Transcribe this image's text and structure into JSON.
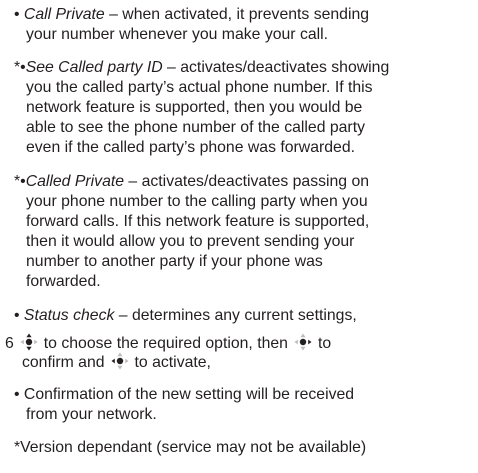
{
  "items": [
    {
      "marker": "•",
      "term": "Call Private",
      "dash": " – ",
      "lines": [
        "when activated, it prevents sending",
        "your number whenever you make your call."
      ]
    },
    {
      "marker": "*•",
      "term": "See Called party ID",
      "dash": " –  ",
      "lines": [
        "activates/deactivates showing",
        "you the called party’s actual phone number. If this",
        "network feature is supported, then you would be",
        "able to see the phone number of the called party",
        "even if the called party’s phone was forwarded."
      ]
    },
    {
      "marker": "*•",
      "term": "Called Private",
      "dash": " –  ",
      "lines": [
        "activates/deactivates passing on",
        "your phone number to the calling party when you",
        "forward calls. If this network feature is supported,",
        "then it would allow you to prevent sending your",
        "number to another party if your phone was",
        "forwarded."
      ]
    },
    {
      "marker": "•",
      "term": "Status check",
      "dash": " – ",
      "lines": [
        "determines any current settings,"
      ]
    }
  ],
  "step": {
    "number": "6",
    "seg1": "to choose the required option, then",
    "seg2": "to",
    "line2_a": "confirm and",
    "line2_b": "to activate,"
  },
  "confirmation": {
    "marker": "•",
    "lines": [
      "Confirmation of the new setting will be received",
      "from your network."
    ]
  },
  "footnote": "*Version dependant (service may not be available)",
  "icons": {
    "joystick_updown": "navigate-up-down-icon",
    "joystick_right": "navigate-right-icon",
    "joystick_left": "navigate-left-icon"
  }
}
